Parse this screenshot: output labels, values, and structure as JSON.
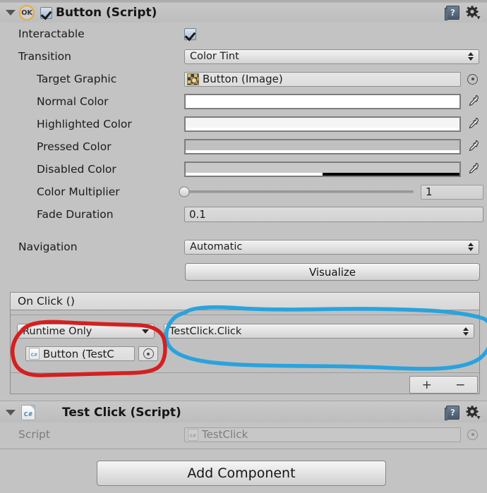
{
  "window": {
    "app": "Unity Inspector",
    "background_color": "#c3c3c3"
  },
  "button_component": {
    "title": "Button (Script)",
    "badge_label": "OK",
    "enabled_checkbox": true,
    "help_icon": "help-book-icon",
    "gear_icon": "gear-icon",
    "foldout_icon": "foldout-triangle-down-icon",
    "rows": {
      "interactable": {
        "label": "Interactable",
        "checked": true
      },
      "transition": {
        "label": "Transition",
        "value": "Color Tint"
      },
      "target_graphic": {
        "label": "Target Graphic",
        "value": "Button (Image)"
      },
      "normal_color": {
        "label": "Normal Color",
        "swatch": "#ffffff",
        "alpha_percent": 100
      },
      "highlighted_color": {
        "label": "Highlighted Color",
        "swatch": "#f5f5f5",
        "alpha_percent": 100
      },
      "pressed_color": {
        "label": "Pressed Color",
        "swatch": "#c0c0c0",
        "alpha_percent": 100
      },
      "disabled_color": {
        "label": "Disabled Color",
        "swatch": "#c8c8c8",
        "alpha_percent": 50
      },
      "color_multiplier": {
        "label": "Color Multiplier",
        "value": "1",
        "slider_percent": 0
      },
      "fade_duration": {
        "label": "Fade Duration",
        "value": "0.1"
      },
      "navigation": {
        "label": "Navigation",
        "value": "Automatic"
      },
      "visualize_button": {
        "label": "Visualize"
      }
    },
    "on_click": {
      "header": "On Click ()",
      "entries": [
        {
          "mode": "Runtime Only",
          "function": "TestClick.Click",
          "object": "Button (TestC"
        }
      ],
      "add_label": "+",
      "remove_label": "−"
    }
  },
  "test_click_component": {
    "title": "Test Click (Script)",
    "script_label": "Script",
    "script_value": "TestClick",
    "cs_badge": "C#",
    "help_icon": "help-book-icon",
    "gear_icon": "gear-icon"
  },
  "add_component_button": {
    "label": "Add Component"
  },
  "annotations": {
    "red_circle": {
      "color": "#d42020",
      "targets": "Runtime Only dropdown and Button (TestClick) object field"
    },
    "blue_circle": {
      "color": "#29a3dd",
      "targets": "TestClick.Click function dropdown row"
    }
  }
}
